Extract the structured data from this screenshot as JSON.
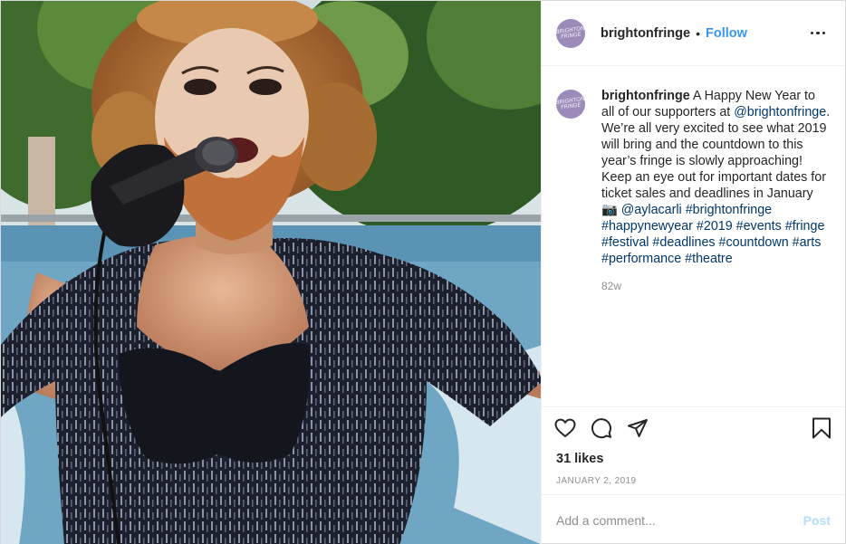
{
  "post": {
    "image": {
      "subject": "drag performer with auburn curled wig and ginger beard singing into a microphone, wearing a black sequined fringe top and black glove, outdoors with trees and a blue banner"
    },
    "header": {
      "avatar_text": "BRIGHTON FRINGE",
      "username": "brightonfringe",
      "separator": "•",
      "follow_label": "Follow",
      "more_icon": "more-horizontal-icon"
    },
    "caption": {
      "avatar_text": "BRIGHTON FRINGE",
      "username": "brightonfringe",
      "text_1": " A Happy New Year to all of our supporters at ",
      "mention": "@brightonfringe",
      "text_2": ". We’re all very excited to see what 2019 will bring and the countdown to this year’s fringe is slowly approaching! Keep an eye out for important dates for ticket sales and deadlines in January ",
      "camera_emoji": "📷",
      "credit": " @aylacarli",
      "hashtags": "#brightonfringe #happynewyear #2019 #events #fringe #festival #deadlines #countdown #arts #performance #theatre",
      "time_ago": "82w"
    },
    "actions": {
      "like_icon": "heart-icon",
      "comment_icon": "comment-icon",
      "share_icon": "share-icon",
      "save_icon": "bookmark-icon"
    },
    "likes": "31 likes",
    "date": "JANUARY 2, 2019",
    "add_comment": {
      "placeholder": "Add a comment...",
      "post_label": "Post"
    },
    "colors": {
      "link": "#00376b",
      "follow": "#3897f0",
      "post_disabled": "#b2dffc",
      "avatar": "#9c8bb8"
    }
  }
}
